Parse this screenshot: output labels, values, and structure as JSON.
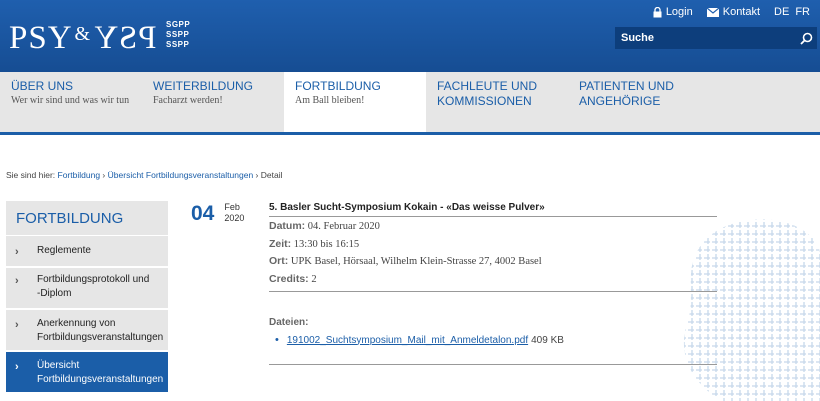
{
  "header": {
    "logo_text_left": "PSY",
    "logo_amp": "&",
    "logo_text_right": "PSY",
    "logo_codes": [
      "SGPP",
      "SSPP",
      "SSPP"
    ],
    "login_label": "Login",
    "contact_label": "Kontakt",
    "languages": [
      "DE",
      "FR"
    ],
    "search_placeholder": "Suche",
    "icons": {
      "login": "lock-icon",
      "contact": "envelope-icon",
      "search": "search-icon"
    }
  },
  "nav": [
    {
      "title": "ÜBER UNS",
      "subtitle": "Wer wir sind und was wir tun"
    },
    {
      "title": "WEITERBILDUNG",
      "subtitle": "Facharzt werden!"
    },
    {
      "title": "FORTBILDUNG",
      "subtitle": "Am Ball bleiben!"
    },
    {
      "title": "FACHLEUTE UND KOMMISSIONEN",
      "subtitle": ""
    },
    {
      "title": "PATIENTEN UND ANGEHÖRIGE",
      "subtitle": ""
    }
  ],
  "breadcrumb": {
    "prefix": "Sie sind hier:",
    "links": [
      "Fortbildung",
      "Übersicht Fortbildungsveranstaltungen"
    ],
    "sep": "›",
    "current": "Detail"
  },
  "sidebar": {
    "title": "FORTBILDUNG",
    "items": [
      {
        "label": "Reglemente"
      },
      {
        "label": "Fortbildungsprotokoll und -Diplom"
      },
      {
        "label": "Anerkennung von Fortbildungsveranstaltungen"
      },
      {
        "label": "Übersicht Fortbildungsveranstaltungen"
      }
    ]
  },
  "event": {
    "day": "04",
    "month": "Feb",
    "year": "2020",
    "title": "5. Basler Sucht-Symposium Kokain - «Das weisse Pulver»",
    "date_label": "Datum:",
    "date_value": "04. Februar 2020",
    "time_label": "Zeit:",
    "time_value": "13:30 bis 16:15",
    "place_label": "Ort:",
    "place_value": "UPK Basel, Hörsaal, Wilhelm Klein-Strasse 27, 4002 Basel",
    "credits_label": "Credits:",
    "credits_value": "2",
    "files_label": "Dateien:",
    "files": [
      {
        "name": "191002_Suchtsymposium_Mail_mit_Anmeldetalon.pdf",
        "size": "409 KB"
      }
    ]
  },
  "colors": {
    "brand": "#1b5ea8",
    "header": "#1f5fae",
    "nav_bg": "#e6e6e6"
  }
}
